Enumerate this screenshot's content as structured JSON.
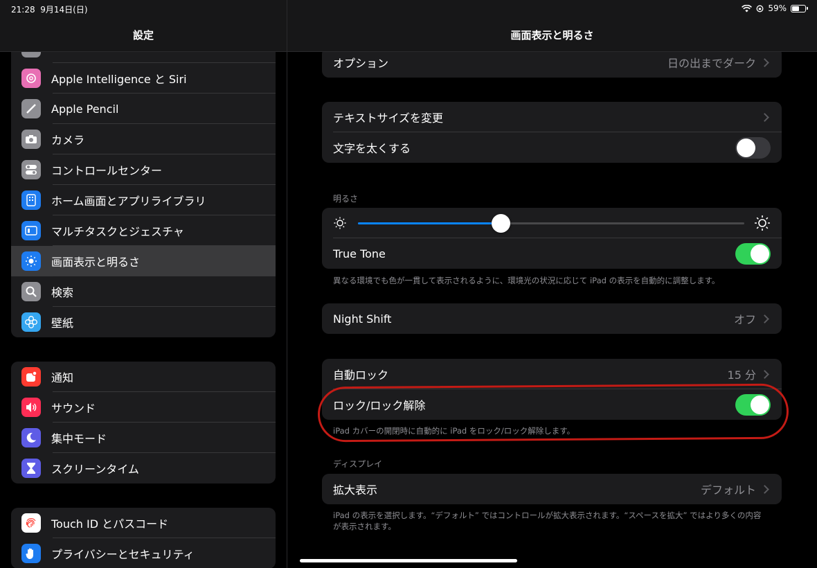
{
  "status_bar": {
    "time": "21:28",
    "date": "9月14日(日)",
    "battery_text": "59%",
    "battery_level": 0.59
  },
  "sidebar": {
    "title": "設定",
    "group1": [
      {
        "label": "Apple Intelligence と Siri",
        "icon": "apple-intelligence-icon",
        "color": "#e86fb4"
      },
      {
        "label": "Apple Pencil",
        "icon": "pencil-icon",
        "color": "#8e8e93"
      },
      {
        "label": "カメラ",
        "icon": "camera-icon",
        "color": "#8e8e93"
      },
      {
        "label": "コントロールセンター",
        "icon": "control-center-icon",
        "color": "#8e8e93"
      },
      {
        "label": "ホーム画面とアプリライブラリ",
        "icon": "home-screen-icon",
        "color": "#1e7cf0"
      },
      {
        "label": "マルチタスクとジェスチャ",
        "icon": "multitasking-icon",
        "color": "#1e7cf0"
      },
      {
        "label": "画面表示と明るさ",
        "icon": "brightness-icon",
        "color": "#1e7cf0",
        "selected": true
      },
      {
        "label": "検索",
        "icon": "search-icon",
        "color": "#8e8e93"
      },
      {
        "label": "壁紙",
        "icon": "wallpaper-icon",
        "color": "#35a6f0"
      }
    ],
    "group2": [
      {
        "label": "通知",
        "icon": "notifications-icon",
        "color": "#ff3b30"
      },
      {
        "label": "サウンド",
        "icon": "sound-icon",
        "color": "#ff2d55"
      },
      {
        "label": "集中モード",
        "icon": "focus-moon-icon",
        "color": "#5e5ce6"
      },
      {
        "label": "スクリーンタイム",
        "icon": "hourglass-icon",
        "color": "#5e5ce6"
      }
    ],
    "group3": [
      {
        "label": "Touch ID とパスコード",
        "icon": "fingerprint-icon",
        "color": "#ffffff"
      },
      {
        "label": "プライバシーとセキュリティ",
        "icon": "privacy-hand-icon",
        "color": "#1e7cf0"
      }
    ]
  },
  "main": {
    "title": "画面表示と明るさ",
    "options_row": {
      "label": "オプション",
      "value": "日の出までダーク"
    },
    "text_card": {
      "text_size": "テキストサイズを変更",
      "bold_text": "文字を太くする",
      "bold_on": false
    },
    "brightness": {
      "section": "明るさ",
      "level": 0.37,
      "true_tone": "True Tone",
      "true_tone_on": true,
      "footnote": "異なる環境でも色が一貫して表示されるように、環境光の状況に応じて iPad の表示を自動的に調整します。"
    },
    "night_shift": {
      "label": "Night Shift",
      "value": "オフ"
    },
    "lock": {
      "auto_lock": "自動ロック",
      "auto_lock_value": "15 分",
      "lock_unlock": "ロック/ロック解除",
      "lock_unlock_on": true,
      "footnote": "iPad カバーの開閉時に自動的に iPad をロック/ロック解除します。"
    },
    "display": {
      "section": "ディスプレイ",
      "zoom_label": "拡大表示",
      "zoom_value": "デフォルト",
      "footnote": "iPad の表示を選択します。“デフォルト” ではコントロールが拡大表示されます。“スペースを拡大” ではより多くの内容が表示されます。"
    }
  },
  "colors": {
    "accent_blue": "#0a84ff",
    "toggle_green": "#30d158",
    "highlight_red": "#c41b15"
  }
}
